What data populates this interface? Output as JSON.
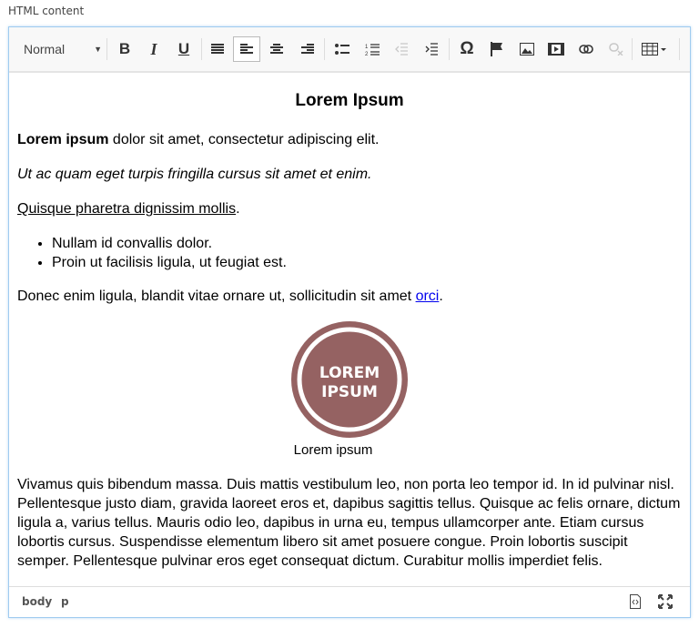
{
  "field_label": "HTML content",
  "toolbar": {
    "format_value": "Normal",
    "bold": "B",
    "italic": "I",
    "underline": "U",
    "special_char": "Ω"
  },
  "content": {
    "heading": "Lorem Ipsum",
    "p1_bold": "Lorem ipsum",
    "p1_rest": " dolor sit amet, consectetur adipiscing elit.",
    "p2": "Ut ac quam eget turpis fringilla cursus sit amet et enim.",
    "p3": "Quisque pharetra dignissim mollis",
    "p3_end": ".",
    "list": [
      "Nullam id convallis dolor.",
      "Proin ut facilisis ligula, ut feugiat est."
    ],
    "p4": "Donec enim ligula, blandit vitae ornare ut, sollicitudin sit amet ",
    "p4_link": "orci",
    "p4_end": ".",
    "image_text": [
      "LOREM",
      "IPSUM"
    ],
    "image_color": "#956262",
    "caption": "Lorem ipsum",
    "p5": "Vivamus quis bibendum massa. Duis mattis vestibulum leo, non porta leo tempor id. In id pulvinar nisl. Pellentesque justo diam, gravida laoreet eros et, dapibus sagittis tellus. Quisque ac felis ornare, dictum ligula a, varius tellus. Mauris odio leo, dapibus in urna eu, tempus ullamcorper ante. Etiam cursus lobortis cursus. Suspendisse elementum libero sit amet posuere congue. Proin lobortis suscipit semper. Pellentesque pulvinar eros eget consequat dictum. Curabitur mollis imperdiet felis."
  },
  "footer": {
    "path": [
      "body",
      "p"
    ]
  }
}
